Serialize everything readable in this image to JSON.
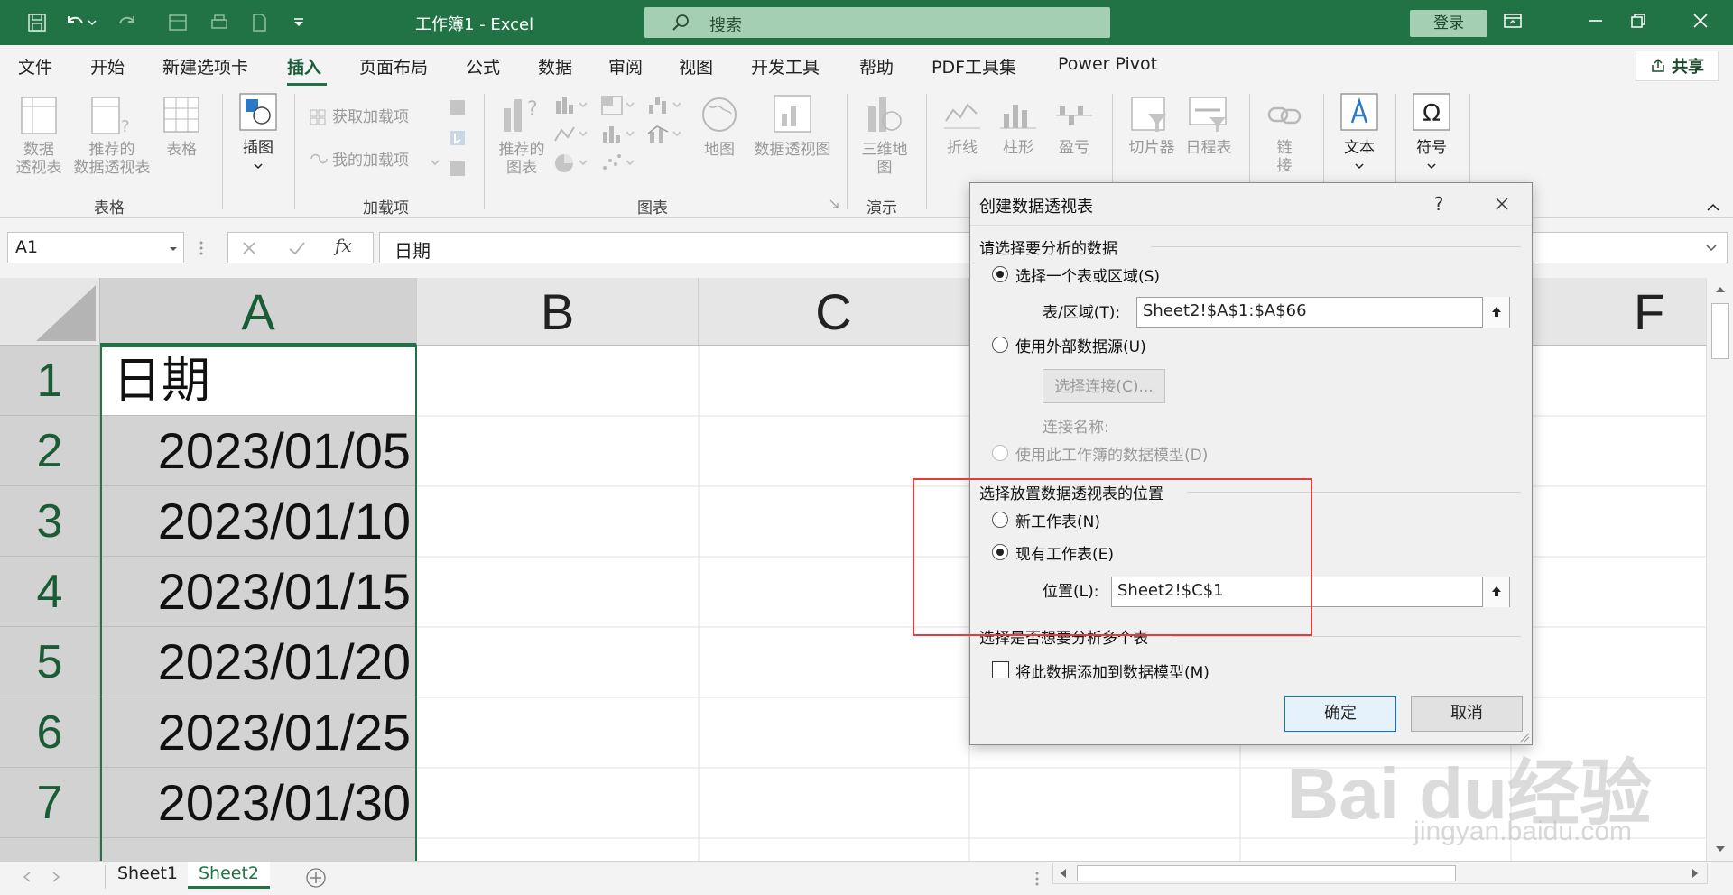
{
  "titlebar": {
    "title": "工作簿1 - Excel",
    "search_label": "搜索",
    "login": "登录"
  },
  "menu": {
    "items": [
      "文件",
      "开始",
      "新建选项卡",
      "插入",
      "页面布局",
      "公式",
      "数据",
      "审阅",
      "视图",
      "开发工具",
      "帮助",
      "PDF工具集",
      "Power Pivot"
    ],
    "active": "插入",
    "share": "共享"
  },
  "ribbon": {
    "table_group": {
      "label": "表格",
      "pivot": "数据\n透视表",
      "recommended_pivot": "推荐的\n数据透视表",
      "table": "表格"
    },
    "illustration": {
      "label": "插图"
    },
    "addins_group": {
      "label": "加载项",
      "get_addins": "获取加载项",
      "my_addins": "我的加载项"
    },
    "charts_group": {
      "label": "图表",
      "recommended": "推荐的\n图表",
      "map": "地图",
      "pivot_chart": "数据透视图"
    },
    "tour_group": {
      "label": "演示",
      "map3d": "三维地\n图"
    },
    "sparklines": {
      "line": "折线",
      "column": "柱形",
      "winloss": "盈亏"
    },
    "filters": {
      "slicer": "切片器",
      "timeline": "日程表"
    },
    "links": {
      "link": "链\n接"
    },
    "text": {
      "label": "文本"
    },
    "symbols": {
      "label": "符号"
    }
  },
  "formula_bar": {
    "namebox": "A1",
    "fx": "fx",
    "content": "日期"
  },
  "grid": {
    "columns": [
      "A",
      "B",
      "C",
      "F"
    ],
    "rows": [
      "1",
      "2",
      "3",
      "4",
      "5",
      "6",
      "7"
    ],
    "col_a": [
      "日期",
      "2023/01/05",
      "2023/01/10",
      "2023/01/15",
      "2023/01/20",
      "2023/01/25",
      "2023/01/30"
    ]
  },
  "sheets": [
    "Sheet1",
    "Sheet2"
  ],
  "active_sheet": "Sheet2",
  "dialog": {
    "title": "创建数据透视表",
    "help": "?",
    "section1": "请选择要分析的数据",
    "opt_table": "选择一个表或区域(S)",
    "range_label": "表/区域(T):",
    "range_value": "Sheet2!$A$1:$A$66",
    "opt_external": "使用外部数据源(U)",
    "choose_conn": "选择连接(C)...",
    "conn_name": "连接名称:",
    "opt_model": "使用此工作簿的数据模型(D)",
    "section2": "选择放置数据透视表的位置",
    "opt_new": "新工作表(N)",
    "opt_existing": "现有工作表(E)",
    "location_label": "位置(L):",
    "location_value": "Sheet2!$C$1",
    "section3": "选择是否想要分析多个表",
    "add_model": "将此数据添加到数据模型(M)",
    "ok": "确定",
    "cancel": "取消"
  },
  "watermark": {
    "brand": "Bai du经验",
    "url": "jingyan.baidu.com"
  },
  "colors": {
    "accent": "#217346",
    "highlight": "#e23c3c"
  }
}
